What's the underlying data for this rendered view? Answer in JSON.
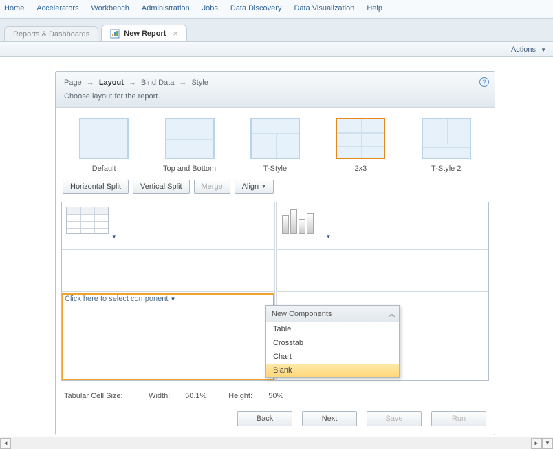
{
  "menu": {
    "items": [
      "Home",
      "Accelerators",
      "Workbench",
      "Administration",
      "Jobs",
      "Data Discovery",
      "Data Visualization",
      "Help"
    ]
  },
  "tabs": {
    "inactive": "Reports & Dashboards",
    "active": "New Report"
  },
  "actionbar": {
    "actions": "Actions"
  },
  "breadcrumb": {
    "step1": "Page",
    "step2": "Layout",
    "step3": "Bind Data",
    "step4": "Style"
  },
  "subhead": "Choose layout for the report.",
  "layouts": {
    "opt1": "Default",
    "opt2": "Top and Bottom",
    "opt3": "T-Style",
    "opt4": "2x3",
    "opt5": "T-Style 2"
  },
  "toolbar": {
    "hsplit": "Horizontal Split",
    "vsplit": "Vertical Split",
    "merge": "Merge",
    "align": "Align"
  },
  "cellprompt": "Click here to select component",
  "popup": {
    "title": "New Components",
    "items": [
      "Table",
      "Crosstab",
      "Chart",
      "Blank"
    ],
    "hoverIndex": 3
  },
  "status": {
    "label": "Tabular Cell Size:",
    "widthLabel": "Width:",
    "widthVal": "50.1%",
    "heightLabel": "Height:",
    "heightVal": "50%"
  },
  "footer": {
    "back": "Back",
    "next": "Next",
    "save": "Save",
    "run": "Run"
  }
}
